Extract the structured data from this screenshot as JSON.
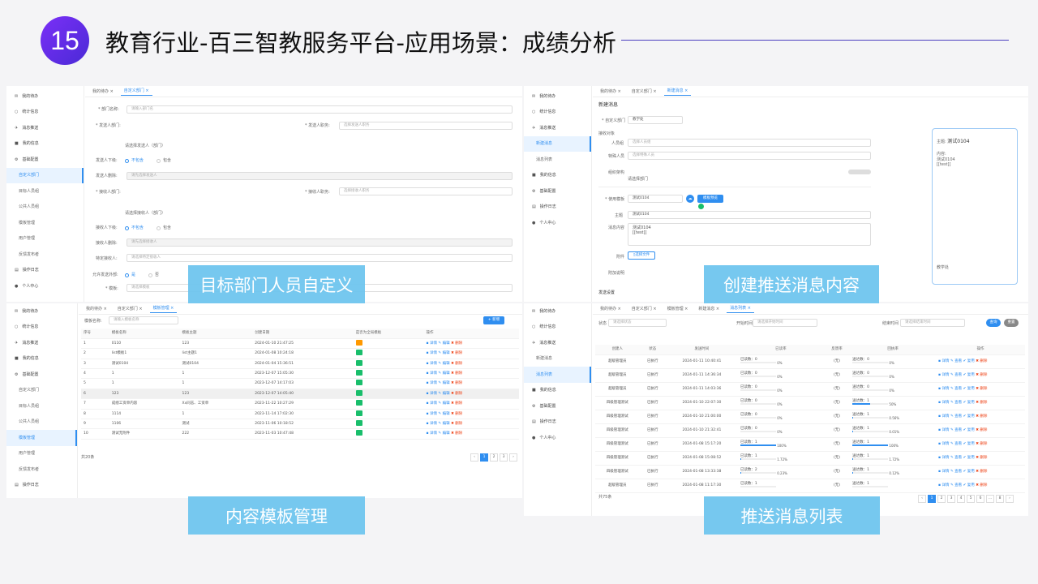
{
  "slide": {
    "number": "15",
    "title": "教育行业-百三智教服务平台-应用场景：成绩分析"
  },
  "labels": {
    "panel1": "目标部门人员自定义",
    "panel2": "创建推送消息内容",
    "panel3": "内容模板管理",
    "panel4": "推送消息列表"
  },
  "colors": {
    "accent": "#2f8ef0",
    "badge": "#6a2cf0",
    "label_bg": "#6cc4ee"
  },
  "sidebar": {
    "items1": [
      {
        "icon": "✉",
        "label": "我的待办",
        "cls": ""
      },
      {
        "icon": "○",
        "label": "统计信息",
        "cls": ""
      },
      {
        "icon": "✈",
        "label": "消息推送",
        "cls": ""
      },
      {
        "icon": "■",
        "label": "我的信息",
        "cls": ""
      },
      {
        "icon": "⚙",
        "label": "基础配置",
        "cls": ""
      },
      {
        "icon": "",
        "label": "自定义部门",
        "cls": "sub act"
      },
      {
        "icon": "",
        "label": "目标人员组",
        "cls": "sub"
      },
      {
        "icon": "",
        "label": "公共人员组",
        "cls": "sub"
      },
      {
        "icon": "",
        "label": "模板管理",
        "cls": "sub"
      },
      {
        "icon": "",
        "label": "用户管理",
        "cls": "sub"
      },
      {
        "icon": "",
        "label": "反馈发布者",
        "cls": "sub"
      },
      {
        "icon": "▤",
        "label": "操作日志",
        "cls": ""
      },
      {
        "icon": "●",
        "label": "个人中心",
        "cls": ""
      }
    ],
    "items2": [
      {
        "icon": "✉",
        "label": "我的待办",
        "cls": ""
      },
      {
        "icon": "○",
        "label": "统计信息",
        "cls": ""
      },
      {
        "icon": "✈",
        "label": "消息推送",
        "cls": ""
      },
      {
        "icon": "",
        "label": "新建消息",
        "cls": "sub act"
      },
      {
        "icon": "",
        "label": "消息列表",
        "cls": "sub"
      },
      {
        "icon": "■",
        "label": "我的信息",
        "cls": ""
      },
      {
        "icon": "⚙",
        "label": "基础配置",
        "cls": ""
      },
      {
        "icon": "▤",
        "label": "操作日志",
        "cls": ""
      },
      {
        "icon": "●",
        "label": "个人中心",
        "cls": ""
      }
    ],
    "items3": [
      {
        "icon": "✉",
        "label": "我的待办",
        "cls": ""
      },
      {
        "icon": "○",
        "label": "统计信息",
        "cls": ""
      },
      {
        "icon": "✈",
        "label": "消息推送",
        "cls": ""
      },
      {
        "icon": "■",
        "label": "我的信息",
        "cls": ""
      },
      {
        "icon": "⚙",
        "label": "基础配置",
        "cls": ""
      },
      {
        "icon": "",
        "label": "自定义部门",
        "cls": "sub"
      },
      {
        "icon": "",
        "label": "目标人员组",
        "cls": "sub"
      },
      {
        "icon": "",
        "label": "公共人员组",
        "cls": "sub"
      },
      {
        "icon": "",
        "label": "模板管理",
        "cls": "sub act"
      },
      {
        "icon": "",
        "label": "用户管理",
        "cls": "sub"
      },
      {
        "icon": "",
        "label": "反馈发布者",
        "cls": "sub"
      },
      {
        "icon": "▤",
        "label": "操作日志",
        "cls": ""
      },
      {
        "icon": "●",
        "label": "个人中心",
        "cls": ""
      }
    ],
    "items4": [
      {
        "icon": "✉",
        "label": "我的待办",
        "cls": ""
      },
      {
        "icon": "○",
        "label": "统计信息",
        "cls": ""
      },
      {
        "icon": "✈",
        "label": "消息推送",
        "cls": ""
      },
      {
        "icon": "",
        "label": "新建消息",
        "cls": "sub"
      },
      {
        "icon": "",
        "label": "消息列表",
        "cls": "sub act"
      },
      {
        "icon": "■",
        "label": "我的信息",
        "cls": ""
      },
      {
        "icon": "⚙",
        "label": "基础配置",
        "cls": ""
      },
      {
        "icon": "▤",
        "label": "操作日志",
        "cls": ""
      },
      {
        "icon": "●",
        "label": "个人中心",
        "cls": ""
      }
    ]
  },
  "tabs": {
    "p1": [
      "我的待办 ×",
      "自定义部门 ×"
    ],
    "p2": [
      "我的待办 ×",
      "自定义部门 ×",
      "新建消息 ×"
    ],
    "p3": [
      "我的待办 ×",
      "自定义部门 ×",
      "模板管理 ×"
    ],
    "p4": [
      "我的待办 ×",
      "自定义部门 ×",
      "模板管理 ×",
      "新建消息 ×",
      "消息列表 ×"
    ]
  },
  "form1": {
    "dept_name": "* 部门名称:",
    "dept_ph": "请输入部门名",
    "sender_dept": "* 发送人部门:",
    "sender_role": "* 发送人职务:",
    "role_ph": "选择发送人职务",
    "sender_hint": "请选择发送人（部门）",
    "sender_sub": "发送人下级:",
    "opt_no": "不包含",
    "opt_yes": "包含",
    "sender_del": "发送人删除:",
    "del_ph": "请先选择发送人",
    "recv_dept": "* 接收人部门:",
    "recv_role": "* 接收人职务:",
    "recv_role_ph": "选择接收人职务",
    "recv_hint": "请选择接收人（部门）",
    "recv_sub": "接收人下级:",
    "recv_del": "接收人删除:",
    "recv_del_ph": "请先选择接收人",
    "special": "特定接收人:",
    "special_ph": "请选择特定接收人",
    "allow": "允许发送外部:",
    "allow_yes": "是",
    "allow_no": "否",
    "template": "* 模板:",
    "template_ph": "请选择模板"
  },
  "form2": {
    "heading": "新建消息",
    "dept": "* 自定义部门",
    "dept_val": "教学处",
    "target": "接收对象",
    "person": "人员组",
    "person_ph": "选择人员组",
    "special": "特殊人员",
    "special_ph": "选择特殊人员",
    "org": "组织架构",
    "org_ph": "请选择部门",
    "template": "* 使用模板",
    "template_val": "测试0104",
    "tpl_btn": "模板预览",
    "subject": "主题",
    "subject_val": "测试0104",
    "content": "消息内容",
    "content_val": "测试0104",
    "content_val2": "[[test]]",
    "attach": "附件",
    "attach_btn": "选择文件",
    "remark": "附加说明",
    "send_set": "发送设置",
    "preview_subject_label": "主题:",
    "preview_subject": "测试0104",
    "preview_content_label": "内容:",
    "preview_content": "测试0104",
    "preview_content2": "[[test]]",
    "preview_footer": "教学处"
  },
  "table3": {
    "search_label": "模板名称:",
    "search_ph": "请输入模板名称",
    "add_btn": "+ 新增",
    "headers": [
      "序号",
      "模板名称",
      "模板主题",
      "创建日期",
      "是否为全局模板",
      "操作"
    ],
    "rows": [
      [
        "1",
        "0110",
        "123",
        "2024-01-10 21:47:25",
        "o"
      ],
      [
        "2",
        "list模板1",
        "list主题1",
        "2024-01-08 10:24:18",
        "g"
      ],
      [
        "3",
        "测试0104",
        "测试0104",
        "2024-01-04 15:36:51",
        "g"
      ],
      [
        "4",
        "1",
        "1",
        "2023-12-07 15:05:30",
        "g"
      ],
      [
        "5",
        "1",
        "1",
        "2023-12-07 14:17:03",
        "g"
      ],
      [
        "6",
        "123",
        "123",
        "2023-12-07 14:05:40",
        "g"
      ],
      [
        "7",
        "成绩工资单内容",
        "Xx同志、工资单",
        "2023-11-22 10:27:29",
        "g"
      ],
      [
        "8",
        "1114",
        "1",
        "2023-11-14 17:02:30",
        "g"
      ],
      [
        "9",
        "1106",
        "测试",
        "2023-11-06 10:18:52",
        "g"
      ],
      [
        "10",
        "测试无附件",
        "222",
        "2023-11-03 10:47:48",
        "g"
      ]
    ],
    "ops": "▪ 详情  ✎ 编辑  ",
    "ops_del": "✖ 删除",
    "total": "共20条",
    "pages": [
      "‹",
      "1",
      "2",
      "3",
      "›"
    ]
  },
  "table4": {
    "filter_status": "状态",
    "status_ph": "请选择状态",
    "filter_start": "开始时间",
    "start_ph": "请选择开始时间",
    "filter_end": "结束时间",
    "end_ph": "请选择结束时间",
    "search_btn": "查询",
    "reset_btn": "重置",
    "headers": [
      "创建人",
      "状态",
      "发送时间",
      "已读率",
      "反馈率",
      "回执率",
      "操作"
    ],
    "rows": [
      {
        "creator": "超级管理员",
        "status": "已执行",
        "time": "2024-01-11 10:40:41",
        "read": "已读数：0",
        "rp": 0,
        "rpt": "0%",
        "fb": "(无)",
        "rc": "送达数：0",
        "rcp": 0,
        "rcpt": "0%"
      },
      {
        "creator": "超级管理员",
        "status": "已执行",
        "time": "2024-01-11 14:36:34",
        "read": "已读数：0",
        "rp": 0,
        "rpt": "0%",
        "fb": "(无)",
        "rc": "送达数：0",
        "rcp": 0,
        "rcpt": "0%"
      },
      {
        "creator": "超级管理员",
        "status": "已执行",
        "time": "2024-01-11 14:03:36",
        "read": "已读数：0",
        "rp": 0,
        "rpt": "0%",
        "fb": "(无)",
        "rc": "送达数：0",
        "rcp": 0,
        "rcpt": "0%"
      },
      {
        "creator": "四级管理测试",
        "status": "已执行",
        "time": "2024-01-10 22:07:30",
        "read": "已读数：0",
        "rp": 0,
        "rpt": "0%",
        "fb": "(无)",
        "rc": "送达数：1",
        "rcp": 50,
        "rcpt": "50%"
      },
      {
        "creator": "四级管理测试",
        "status": "已执行",
        "time": "2024-01-10 21:00:00",
        "read": "已读数：0",
        "rp": 0,
        "rpt": "0%",
        "fb": "(无)",
        "rc": "送达数：1",
        "rcp": 1,
        "rcpt": "0.56%"
      },
      {
        "creator": "四级管理测试",
        "status": "已执行",
        "time": "2024-01-10 21:32:41",
        "read": "已读数：0",
        "rp": 0,
        "rpt": "0%",
        "fb": "(无)",
        "rc": "送达数：1",
        "rcp": 1,
        "rcpt": "0.01%"
      },
      {
        "creator": "四级管理测试",
        "status": "已执行",
        "time": "2024-01-08 15:17:20",
        "read": "已读数：1",
        "rp": 100,
        "rpt": "100%",
        "fb": "(无)",
        "rc": "送达数：1",
        "rcp": 100,
        "rcpt": "100%"
      },
      {
        "creator": "四级管理测试",
        "status": "已执行",
        "time": "2024-01-08 15:08:52",
        "read": "已读数：1",
        "rp": 2,
        "rpt": "1.72%",
        "fb": "(无)",
        "rc": "送达数：1",
        "rcp": 2,
        "rcpt": "1.72%"
      },
      {
        "creator": "四级管理测试",
        "status": "已执行",
        "time": "2024-01-08 13:33:38",
        "read": "已读数：2",
        "rp": 1,
        "rpt": "0.23%",
        "fb": "(无)",
        "rc": "送达数：1",
        "rcp": 1,
        "rcpt": "0.12%"
      },
      {
        "creator": "超级管理员",
        "status": "已执行",
        "time": "2024-01-08 11:17:30",
        "read": "已读数：1",
        "rp": 0,
        "rpt": "",
        "fb": "(无)",
        "rc": "送达数：1",
        "rcp": 0,
        "rcpt": ""
      }
    ],
    "ops": "▪ 详情  ✎ 查看  ✔ 复用  ",
    "ops_del": "✖ 删除",
    "total": "共75条",
    "pages": [
      "‹",
      "1",
      "2",
      "3",
      "4",
      "5",
      "6",
      "…",
      "8",
      "›"
    ]
  }
}
